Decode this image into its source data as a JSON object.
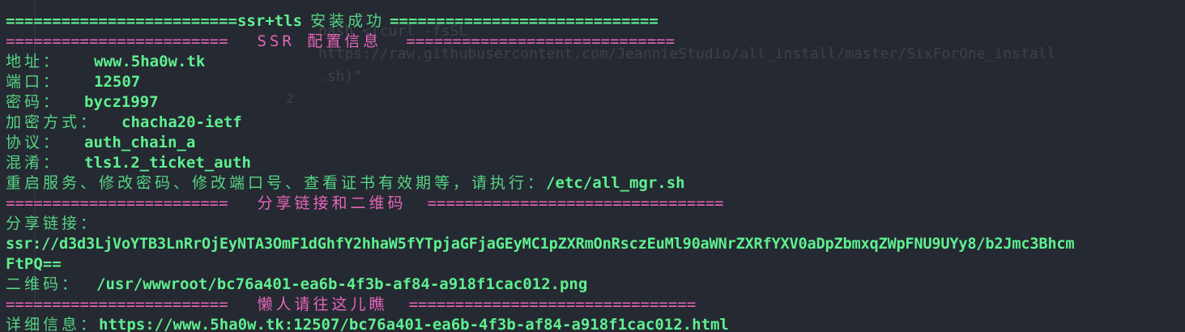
{
  "colors": {
    "background": "#252932",
    "value_green": "#5ef08f",
    "label_green": "#55d584",
    "separator_pink": "#e665b9",
    "ghost_text": "#3c414c"
  },
  "ghost": {
    "text": "bash <(curl -fsSL\nhttps://raw.githubusercontent.com/JeannieStudio/all_install/master/SixForOne_install\n.sh)\"",
    "line_number": "2"
  },
  "header": {
    "left": "=========================ssr+tls",
    "title": "安装成功",
    "right": "============================="
  },
  "ssr_section": {
    "left": "========================",
    "title": "SSR 配置信息",
    "right": "============================="
  },
  "config": {
    "address_label": "地址：",
    "address_value": "www.5ha0w.tk",
    "port_label": "端口：",
    "port_value": "12507",
    "password_label": "密码：",
    "password_value": "bycz1997",
    "method_label": "加密方式：",
    "method_value": "chacha20-ietf",
    "protocol_label": "协议：",
    "protocol_value": "auth_chain_a",
    "obfs_label": "混淆：",
    "obfs_value": "tls1.2_ticket_auth"
  },
  "manage": {
    "label": "重启服务、修改密码、修改端口号、查看证书有效期等，请执行：",
    "command": "/etc/all_mgr.sh"
  },
  "share_section": {
    "left": "========================",
    "title": "分享链接和二维码",
    "right": "================================"
  },
  "share": {
    "label": "分享链接：",
    "link_line1": "ssr://d3d3LjVoYTB3LnRrOjEyNTA3OmF1dGhfY2hhaW5fYTpjaGFjaGEyMC1pZXRmOnRsczEuMl90aWNrZXRfYXV0aDpZbmxqZWpFNU9UYy8/b2Jmc3Bhcm",
    "link_line2": "FtPQ==",
    "qr_label": "二维码：",
    "qr_value": "/usr/wwwroot/bc76a401-ea6b-4f3b-af84-a918f1cac012.png"
  },
  "lazy_section": {
    "left": "========================",
    "title": "懒人请往这儿瞧",
    "right": "==============================="
  },
  "detail": {
    "label": "详细信息：",
    "url": "https://www.5ha0w.tk:12507/bc76a401-ea6b-4f3b-af84-a918f1cac012.html"
  }
}
